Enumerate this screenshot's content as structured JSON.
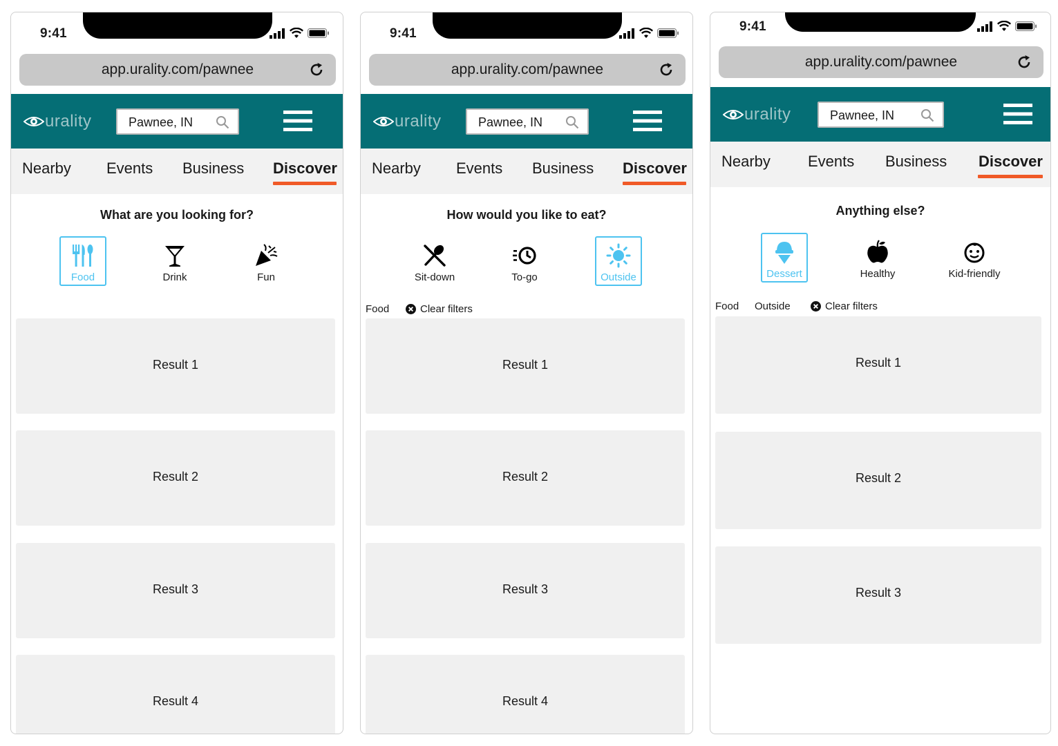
{
  "colors": {
    "header_teal": "#056e75",
    "tab_bar": "#f2f2f2",
    "active_underline": "#f05a28",
    "selection_blue": "#4dc3f0",
    "card_gray": "#f0f0f0",
    "urlbar_gray": "#c8c8c8"
  },
  "screens": [
    {
      "status": {
        "time": "9:41"
      },
      "browser": {
        "url": "app.urality.com/pawnee"
      },
      "header": {
        "brand": "urality",
        "location": "Pawnee, IN"
      },
      "tabs": [
        {
          "label": "Nearby"
        },
        {
          "label": "Events"
        },
        {
          "label": "Business"
        },
        {
          "label": "Discover",
          "active": true
        }
      ],
      "question": "What are you looking for?",
      "options": [
        {
          "label": "Food",
          "icon": "utensils-icon",
          "selected": true
        },
        {
          "label": "Drink",
          "icon": "cocktail-icon",
          "selected": false
        },
        {
          "label": "Fun",
          "icon": "party-popper-icon",
          "selected": false
        }
      ],
      "filters": [],
      "clear_filters_label": "",
      "results": [
        "Result 1",
        "Result 2",
        "Result 3",
        "Result 4"
      ]
    },
    {
      "status": {
        "time": "9:41"
      },
      "browser": {
        "url": "app.urality.com/pawnee"
      },
      "header": {
        "brand": "urality",
        "location": "Pawnee, IN"
      },
      "tabs": [
        {
          "label": "Nearby"
        },
        {
          "label": "Events"
        },
        {
          "label": "Business"
        },
        {
          "label": "Discover",
          "active": true
        }
      ],
      "question": "How would you like to eat?",
      "options": [
        {
          "label": "Sit-down",
          "icon": "fork-spoon-icon",
          "selected": false
        },
        {
          "label": "To-go",
          "icon": "fast-clock-icon",
          "selected": false
        },
        {
          "label": "Outside",
          "icon": "sun-icon",
          "selected": true
        }
      ],
      "filters": [
        "Food"
      ],
      "clear_filters_label": "Clear filters",
      "results": [
        "Result 1",
        "Result 2",
        "Result 3",
        "Result 4"
      ]
    },
    {
      "status": {
        "time": "9:41"
      },
      "browser": {
        "url": "app.urality.com/pawnee"
      },
      "header": {
        "brand": "urality",
        "location": "Pawnee, IN"
      },
      "tabs": [
        {
          "label": "Nearby"
        },
        {
          "label": "Events"
        },
        {
          "label": "Business"
        },
        {
          "label": "Discover",
          "active": true
        }
      ],
      "question": "Anything else?",
      "options": [
        {
          "label": "Dessert",
          "icon": "ice-cream-icon",
          "selected": true
        },
        {
          "label": "Healthy",
          "icon": "apple-icon",
          "selected": false
        },
        {
          "label": "Kid-friendly",
          "icon": "smiley-face-icon",
          "selected": false
        }
      ],
      "filters": [
        "Food",
        "Outside"
      ],
      "clear_filters_label": "Clear filters",
      "results": [
        "Result 1",
        "Result 2",
        "Result 3"
      ]
    }
  ]
}
